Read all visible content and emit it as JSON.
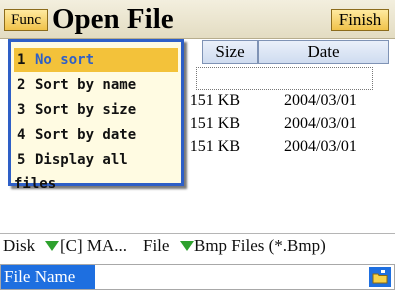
{
  "header": {
    "func_label": "Func",
    "title": "Open File",
    "finish_label": "Finish"
  },
  "columns": {
    "size": "Size",
    "date": "Date"
  },
  "files": [
    {
      "size": "151 KB",
      "date": "2004/03/01"
    },
    {
      "size": "151 KB",
      "date": "2004/03/01"
    },
    {
      "size": "151 KB",
      "date": "2004/03/01"
    }
  ],
  "func_menu": {
    "selected_index": 0,
    "items": [
      {
        "num": "1",
        "label": "No sort"
      },
      {
        "num": "2",
        "label": "Sort by name"
      },
      {
        "num": "3",
        "label": "Sort by size"
      },
      {
        "num": "4",
        "label": "Sort by date"
      },
      {
        "num": "5",
        "label": "Display all files"
      }
    ]
  },
  "disk_bar": {
    "disk_label": "Disk",
    "disk_value": "[C] MA...",
    "file_label": "File",
    "file_value": "Bmp Files (*.Bmp)"
  },
  "filename": {
    "label": "File Name",
    "value": ""
  },
  "icons": {
    "dropdown": "dropdown-triangle-icon",
    "folder": "folder-icon"
  },
  "colors": {
    "accent_blue": "#1e6fe0",
    "menu_highlight": "#f3c23a",
    "button_gold": "#f0c24a",
    "triangle_green": "#2ea12e"
  }
}
